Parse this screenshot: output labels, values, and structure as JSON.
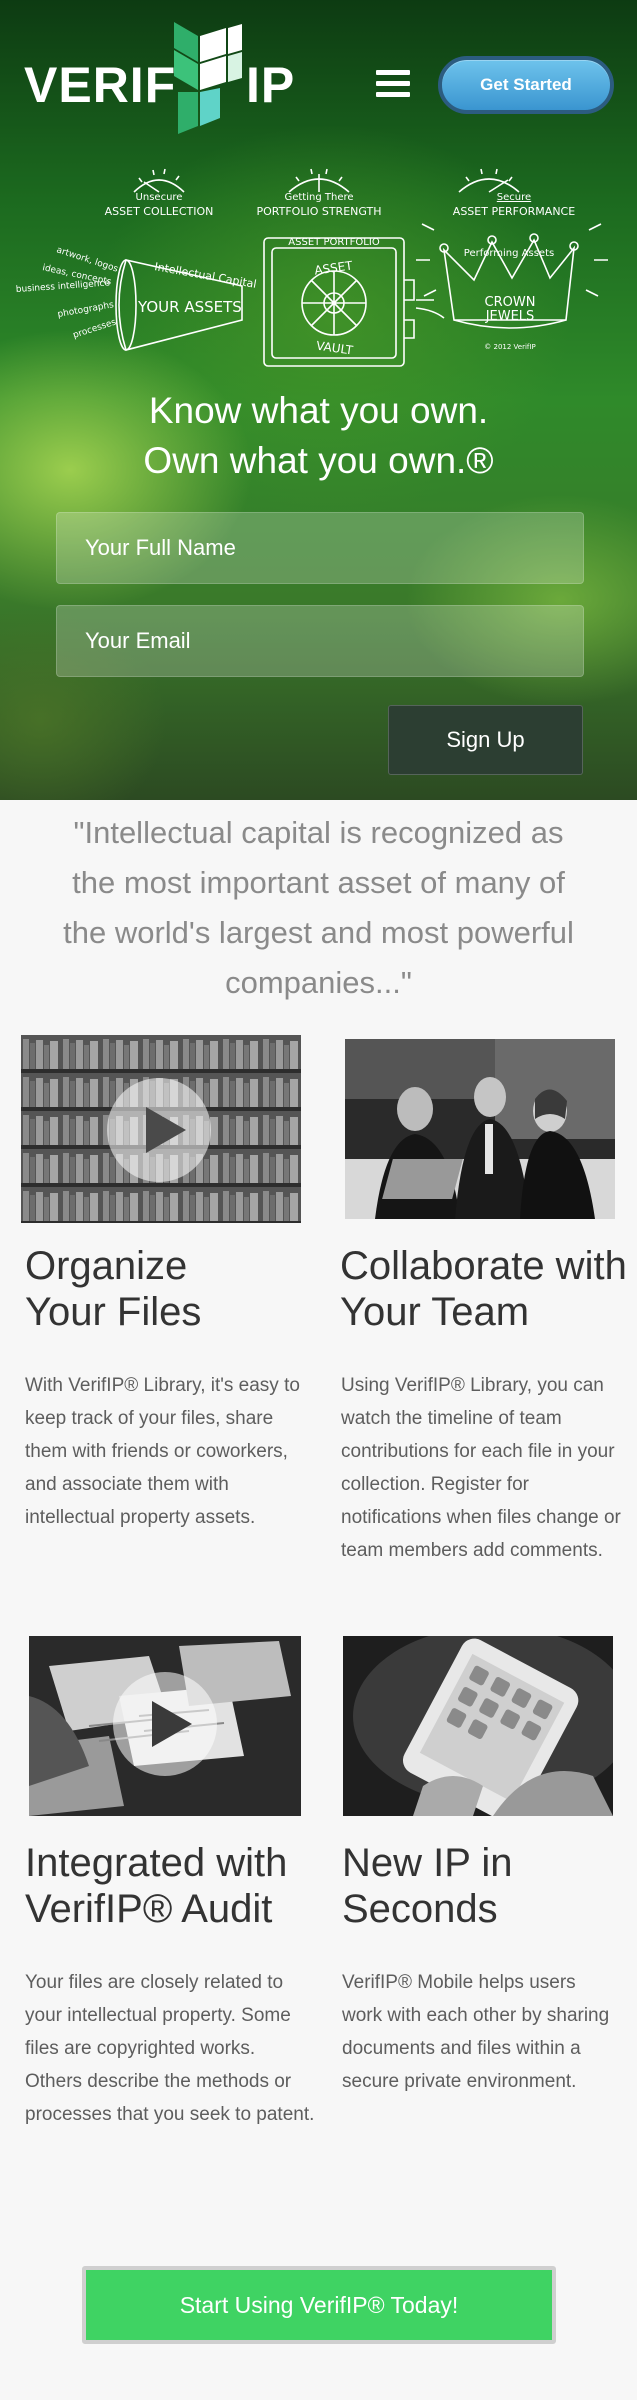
{
  "header": {
    "logo_left": "VERIF",
    "logo_right": "IP",
    "menu_icon": "hamburger-menu-icon",
    "get_started_label": "Get Started"
  },
  "illustration": {
    "label_unsecure_1": "Unsecure",
    "label_unsecure_2": "ASSET COLLECTION",
    "label_getting_1": "Getting There",
    "label_getting_2": "PORTFOLIO STRENGTH",
    "label_secure_1": "Secure",
    "label_secure_2": "ASSET PERFORMANCE",
    "funnel_items": [
      "artwork, logos",
      "ideas, concepts",
      "business intelligence",
      "photographs",
      "processes"
    ],
    "funnel_curve": "Intellectual Capital",
    "funnel_label": "YOUR ASSETS",
    "vault_top": "ASSET PORTFOLIO",
    "vault_word_1": "ASSET",
    "vault_word_2": "VAULT",
    "crown_top": "Performing Assets",
    "crown_label_1": "CROWN",
    "crown_label_2": "JEWELS",
    "copyright": "© 2012 VerifIP"
  },
  "hero": {
    "tagline_line1": "Know what you own.",
    "tagline_line2": "Own what you own.®",
    "name_placeholder": "Your Full Name",
    "email_placeholder": "Your Email",
    "signup_label": "Sign Up"
  },
  "quote": "\"Intellectual capital is recognized as the most important asset of many of the world's largest and most powerful companies...\"",
  "features": [
    {
      "title_1": "Organize",
      "title_2": "Your Files",
      "text": "With VerifIP® Library, it's easy to keep track of your files, share them with friends or coworkers, and associate them with intellectual property assets."
    },
    {
      "title_1": "Collaborate with",
      "title_2": "Your Team",
      "text": "Using VerifIP® Library, you can watch the timeline of team contributions for each file in your collection. Register for notifications when files change or team members add comments."
    },
    {
      "title_1": "Integrated with",
      "title_2": "VerifIP® Audit",
      "text": "Your files are closely related to your intellectual property. Some files are copyrighted works. Others describe the methods or processes that you seek to patent."
    },
    {
      "title_1": "New IP in",
      "title_2": "Seconds",
      "text": "VerifIP® Mobile helps users work with each other by sharing documents and files within a secure private environment."
    }
  ],
  "cta_label": "Start Using VerifIP® Today!",
  "colors": {
    "hero_green": "#2f8a2a",
    "button_blue": "#3a95d0",
    "cta_green": "#3fd363",
    "signup_dark": "#2c3e32"
  }
}
